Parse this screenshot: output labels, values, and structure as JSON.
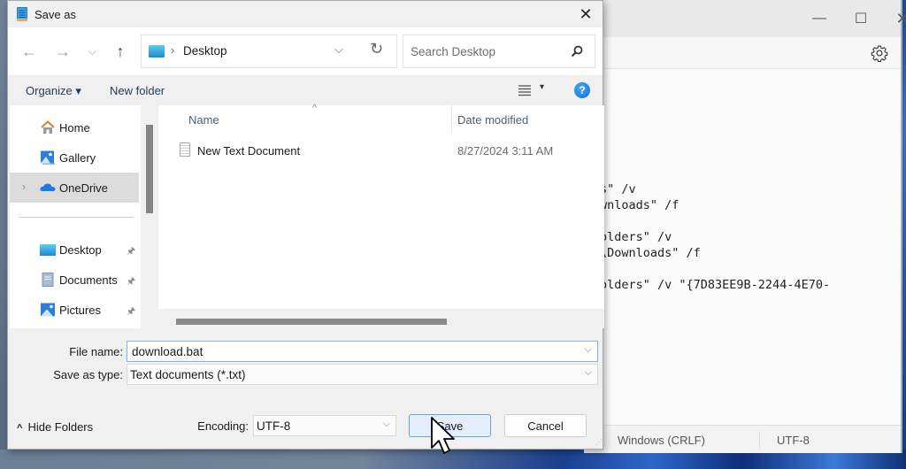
{
  "background_window": {
    "controls": {
      "minimize": "—",
      "maximize": "☐",
      "close": "✕"
    },
    "settings_icon": "gear-icon",
    "editor_lines": [
      "s\" /v",
      "wnloads\" /f",
      "",
      "olders\" /v",
      "\\Downloads\" /f",
      "",
      "olders\" /v \"{7D83EE9B-2244-4E70-"
    ],
    "status": {
      "line_ending": "Windows (CRLF)",
      "encoding": "UTF-8"
    }
  },
  "dialog": {
    "title": "Save as",
    "close_glyph": "✕",
    "nav": {
      "back": "←",
      "forward": "→",
      "recent": "⌵",
      "up": "↑"
    },
    "address": {
      "separator": "›",
      "location": "Desktop",
      "dropdown": "⌵",
      "refresh": "↻"
    },
    "search": {
      "placeholder": "Search Desktop"
    },
    "toolbar": {
      "organize": "Organize ▾",
      "new_folder": "New folder",
      "view_arrow": "▾",
      "help": "?"
    },
    "sidebar": {
      "expand_glyph": "›",
      "pin_glyph": "📌",
      "items": [
        {
          "label": "Home",
          "icon": "home-icon"
        },
        {
          "label": "Gallery",
          "icon": "gallery-icon"
        },
        {
          "label": "OneDrive",
          "icon": "onedrive-icon",
          "selected": true
        },
        {
          "label": "Desktop",
          "icon": "desktop-folder-icon",
          "pinned": true
        },
        {
          "label": "Documents",
          "icon": "documents-icon",
          "pinned": true
        },
        {
          "label": "Pictures",
          "icon": "pictures-icon",
          "pinned": true
        }
      ]
    },
    "file_list": {
      "columns": [
        "Name",
        "Date modified"
      ],
      "sort_glyph": "^",
      "rows": [
        {
          "name": "New Text Document",
          "date_modified": "8/27/2024 3:11 AM"
        }
      ]
    },
    "form": {
      "file_name_label": "File name:",
      "file_name_value": "download.bat",
      "save_type_label": "Save as type:",
      "save_type_value": "Text documents (*.txt)",
      "encoding_label": "Encoding:",
      "encoding_value": "UTF-8",
      "dropdown_glyph": "⌵"
    },
    "footer": {
      "hide_folders_caret": "^",
      "hide_folders": "Hide Folders",
      "save": "Save",
      "cancel": "Cancel"
    }
  }
}
